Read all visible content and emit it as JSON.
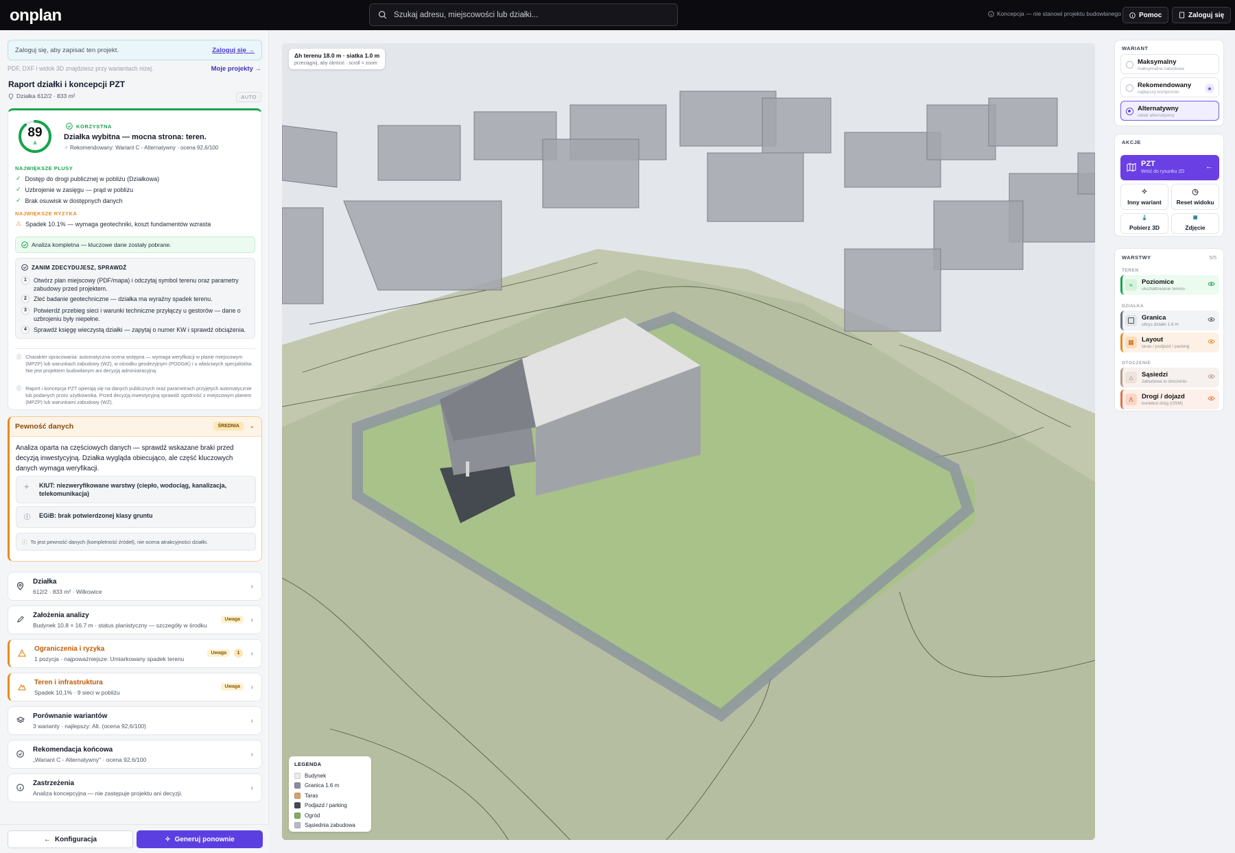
{
  "topbar": {
    "logo": "onplan",
    "search_placeholder": "Szukaj adresu, miejscowości lub działki...",
    "note": "Koncepcja — nie stanowi projektu budowlanego",
    "help": "Pomoc",
    "login": "Zaloguj się"
  },
  "left": {
    "login_text": "Zaloguj się, aby zapisać ten projekt.",
    "login_link": "Zaloguj się →",
    "pdf_note": "PDF, DXF i widok 3D znajdziesz przy wariantach niżej.",
    "my_projects": "Moje projekty →",
    "report_title": "Raport działki i koncepcji PZT",
    "report_sub": "Działka 612/2 · 833 m²",
    "auto": "AUTO",
    "score": "89",
    "score_letter": "A",
    "verdict": "KORZYSTNA",
    "headline": "Działka wybitna — mocna strona: teren.",
    "recommended": "Rekomendowany: Wariant C - Alternatywny · ocena 92,6/100",
    "pluses_label": "NAJWIĘKSZE PLUSY",
    "pluses": [
      "Dostęp do drogi publicznej w pobliżu (Działkowa)",
      "Uzbrojenie w zasięgu — prąd w pobliżu",
      "Brak osuwisk w dostępnych danych"
    ],
    "risks_label": "NAJWIĘKSZE RYZYKA",
    "risks": [
      "Spadek 10.1% — wymaga geotechniki, koszt fundamentów wzrasta"
    ],
    "analysis_note": "Analiza kompletna — kluczowe dane zostały pobrane.",
    "check_title": "ZANIM ZDECYDUJESZ, SPRAWDŹ",
    "checks": [
      {
        "n": "1",
        "t": "Otwórz plan miejscowy (PDF/mapa) i odczytaj symbol terenu oraz parametry zabudowy przed projektem."
      },
      {
        "n": "2",
        "t": "Zleć badanie geotechniczne — działka ma wyraźny spadek terenu."
      },
      {
        "n": "3",
        "t": "Potwierdź przebieg sieci i warunki techniczne przyłączy u gestorów — dane o uzbrojeniu były niepełne."
      },
      {
        "n": "4",
        "t": "Sprawdź księgę wieczystą działki — zapytaj o numer KW i sprawdź obciążenia."
      }
    ],
    "disclaimer1": "Charakter opracowania: automatyczna ocena wstępna — wymaga weryfikacji w planie miejscowym (MPZP) lub warunkach zabudowy (WZ), w ośrodku geodezyjnym (PODGiK) i u właściwych specjalistów. Nie jest projektem budowlanym ani decyzją administracyjną.",
    "disclaimer2": "Raport i koncepcja PZT opierają się na danych publicznych oraz parametrach przyjętych automatycznie lub podanych przez użytkownika. Przed decyzją inwestycyjną sprawdź zgodność z miejscowym planem (MPZP) lub warunkami zabudowy (WZ).",
    "pewnosc_title": "Pewność danych",
    "pewnosc_badge": "ŚREDNIA",
    "pewnosc_text": "Analiza oparta na częściowych danych — sprawdź wskazane braki przed decyzją inwestycyjną. Działka wygląda obiecująco, ale część kluczowych danych wymaga weryfikacji.",
    "pewnosc_items": [
      "KIUT: niezweryfikowane warstwy (ciepło, wodociąg, kanalizacja, telekomunikacja)",
      "EGiB: brak potwierdzonej klasy gruntu"
    ],
    "pewnosc_foot": "To jest pewność danych (kompletność źródeł), nie ocena atrakcyjności działki.",
    "sections": [
      {
        "title": "Działka",
        "sub": "612/2 · 833 m² · Wilkowice"
      },
      {
        "title": "Założenia analizy",
        "sub": "Budynek 10.8 × 16.7 m · status planistyczny — szczegóły w środku",
        "badge": "Uwaga"
      },
      {
        "title": "Ograniczenia i ryzyka",
        "sub": "1 pozycja · najpoważniejsze: Umiarkowany spadek terenu",
        "badge": "Uwaga",
        "count": "1"
      },
      {
        "title": "Teren i infrastruktura",
        "sub": "Spadek 10,1% · 9 sieci w pobliżu",
        "badge": "Uwaga"
      },
      {
        "title": "Porównanie wariantów",
        "sub": "3 warianty · najlepszy: Alt. (ocena 92,6/100)"
      },
      {
        "title": "Rekomendacja końcowa",
        "sub": "„Wariant C - Alternatywny\" · ocena 92,6/100"
      },
      {
        "title": "Zastrzeżenia",
        "sub": "Analiza koncepcyjna — nie zastępuje projektu ani decyzji."
      }
    ],
    "btn_config": "Konfiguracja",
    "btn_generate": "Generuj ponownie"
  },
  "viewport": {
    "chip_line1": "Δh terenu 18.0 m · siatka 1.0 m",
    "chip_line2": "przeciągnij, aby obrócić · scroll = zoom",
    "legend_title": "LEGENDA",
    "legend": [
      {
        "label": "Budynek",
        "color": "#ececec"
      },
      {
        "label": "Granica 1.6 m",
        "color": "#8a90a0"
      },
      {
        "label": "Taras",
        "color": "#d9a36a"
      },
      {
        "label": "Podjazd / parking",
        "color": "#444a50"
      },
      {
        "label": "Ogród",
        "color": "#7fae5f"
      },
      {
        "label": "Sąsiednia zabudowa",
        "color": "#b9bcc3"
      }
    ]
  },
  "right": {
    "variant_label": "WARIANT",
    "variants": [
      {
        "name": "Maksymalny",
        "sub": "maksymalna zabudowa"
      },
      {
        "name": "Rekomendowany",
        "sub": "najlepszy kompromis"
      },
      {
        "name": "Alternatywny",
        "sub": "układ alternatywny"
      }
    ],
    "actions_label": "AKCJE",
    "pzt_title": "PZT",
    "pzt_sub": "Wróć do rysunku 2D",
    "actions": [
      "Inny wariant",
      "Reset widoku",
      "Pobierz 3D",
      "Zdjęcie"
    ],
    "layers_label": "WARSTWY",
    "layers_count": "5/5",
    "groups": [
      "TEREN",
      "DZIAŁKA",
      "OTOCZENIE"
    ],
    "layers": [
      {
        "name": "Poziomice",
        "sub": "ukształtowanie terenu"
      },
      {
        "name": "Granica",
        "sub": "obrys działki 1.6 m"
      },
      {
        "name": "Layout",
        "sub": "taras / podjazd / parking"
      },
      {
        "name": "Sąsiedzi",
        "sub": "zabudowa w otoczeniu"
      },
      {
        "name": "Drogi / dojazd",
        "sub": "kontekst dróg (OSM)"
      }
    ]
  },
  "colors": {
    "accent": "#5b3fe0",
    "good": "#16a34a",
    "warn": "#e58a1f"
  }
}
